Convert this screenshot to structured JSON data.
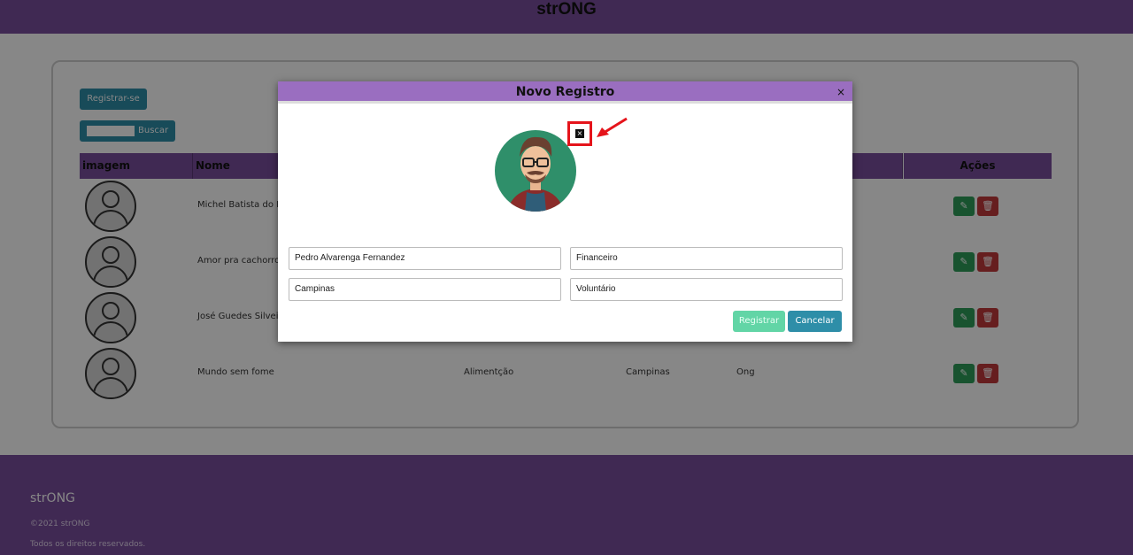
{
  "app": {
    "brand": "strONG"
  },
  "toolbar": {
    "register_label": "Registrar-se",
    "search_label": "Buscar",
    "search_value": ""
  },
  "table": {
    "headers": [
      "imagem",
      "Nome",
      "Ações"
    ],
    "rows": [
      {
        "name": "Michel Batista do N",
        "area": "",
        "city": "",
        "type": ""
      },
      {
        "name": "Amor pra cachorro",
        "area": "",
        "city": "",
        "type": ""
      },
      {
        "name": "José Guedes Silvei",
        "area": "",
        "city": "",
        "type": ""
      },
      {
        "name": "Mundo sem fome",
        "area": "Alimentção",
        "city": "Campinas",
        "type": "Ong"
      }
    ]
  },
  "modal": {
    "title": "Novo Registro",
    "close_icon": "×",
    "remove_image_icon": "×",
    "fields": {
      "name": "Pedro Alvarenga Fernandez",
      "area": "Financeiro",
      "city": "Campinas",
      "role": "Voluntário"
    },
    "register_label": "Registrar",
    "cancel_label": "Cancelar"
  },
  "footer": {
    "brand_prefix": "str",
    "brand_suffix": "ONG",
    "copyright": "©2021 strONG",
    "rights": "Todos os direitos reservados."
  },
  "colors": {
    "primary": "#7a4e9e",
    "modal_header": "#9a6ec0",
    "teal": "#2e8ea8",
    "annotation": "#e5141b"
  }
}
